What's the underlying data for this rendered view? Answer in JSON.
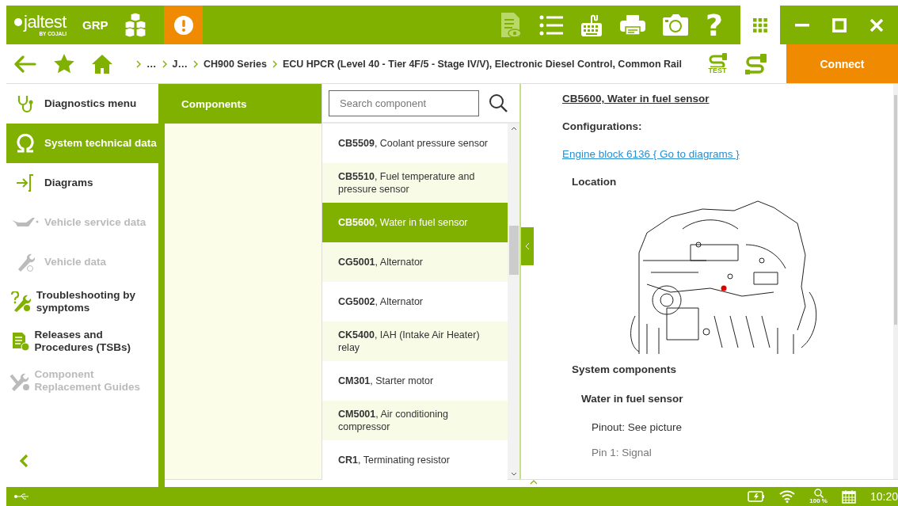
{
  "top_bar": {
    "logo": {
      "wordmark": "jaltest",
      "byline": "BY COJALI"
    },
    "profile": "GRP",
    "tools": [
      {
        "kind": "document-view",
        "disabled": true
      },
      {
        "kind": "list",
        "disabled": false
      },
      {
        "kind": "keyboard",
        "disabled": false
      },
      {
        "kind": "printer",
        "disabled": false
      },
      {
        "kind": "camera",
        "disabled": false
      },
      {
        "kind": "help",
        "disabled": false,
        "glyph": "?"
      }
    ]
  },
  "nav_bar": {
    "breadcrumbs": [
      "…",
      "J…",
      "CH900 Series",
      "ECU HPCR (Level 40 - Tier 4F/5 - Stage IV/V), Electronic Diesel Control, Common Rail"
    ],
    "test_label": "TEST",
    "connect_button": "Connect"
  },
  "sidebar": {
    "items": [
      {
        "kind": "stethoscope",
        "label": "Diagnostics menu",
        "selected": false,
        "disabled": false
      },
      {
        "kind": "omega",
        "label": "System technical data",
        "selected": true,
        "disabled": false
      },
      {
        "kind": "diagram",
        "label": "Diagrams",
        "selected": false,
        "disabled": false
      },
      {
        "kind": "oil-can",
        "label": "Vehicle service data",
        "selected": false,
        "disabled": true
      },
      {
        "kind": "wrench",
        "label": "Vehicle data",
        "selected": false,
        "disabled": true
      },
      {
        "kind": "troubleshoot",
        "label": "Troubleshooting by symptoms",
        "selected": false,
        "disabled": false
      },
      {
        "kind": "document",
        "label": "Releases and Procedures (TSBs)",
        "selected": false,
        "disabled": false
      },
      {
        "kind": "tools",
        "label": "Component Replacement Guides",
        "selected": false,
        "disabled": true
      }
    ]
  },
  "categories": {
    "items": [
      {
        "label": "Components",
        "selected": true
      }
    ]
  },
  "components": {
    "search": {
      "placeholder": "Search component"
    },
    "items": [
      {
        "text": "**CB5509**, Coolant pressure sensor",
        "selected": false
      },
      {
        "text": "**CB5510**, Fuel temperature and pressure sensor",
        "selected": false
      },
      {
        "text": "**CB5600**, Water in fuel sensor",
        "selected": true
      },
      {
        "text": "**CG5001**, Alternator",
        "selected": false
      },
      {
        "text": "**CG5002**, Alternator",
        "selected": false
      },
      {
        "text": "**CK5400**, IAH (Intake Air Heater) relay",
        "selected": false
      },
      {
        "text": "**CM301**, Starter motor",
        "selected": false
      },
      {
        "text": "**CM5001**, Air conditioning compressor",
        "selected": false
      },
      {
        "text": "**CR1**, Terminating resistor",
        "selected": false
      }
    ]
  },
  "detail": {
    "title": "CB5600, Water in fuel sensor",
    "configurations_label": "Configurations:",
    "configuration_link": "Engine block 6136 { Go to diagrams }",
    "location_label": "Location",
    "system_components_label": "System components",
    "component_name": "Water in fuel sensor",
    "pinout": "Pinout: See picture",
    "pin_1": "Pin 1: Signal"
  },
  "status_bar": {
    "zoom": "100 %",
    "time": "10:20"
  }
}
